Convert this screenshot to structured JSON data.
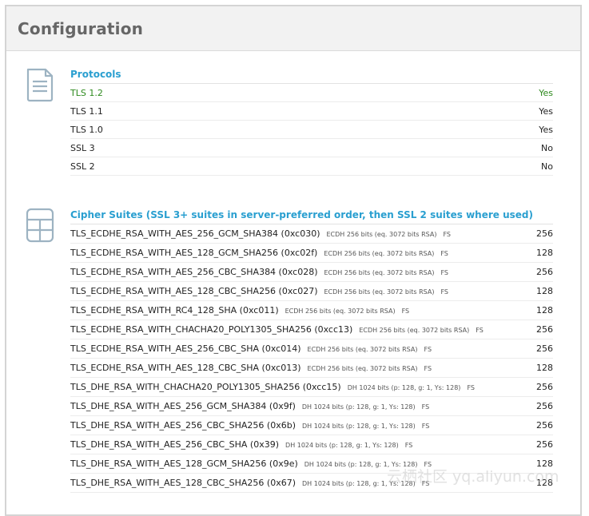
{
  "header": {
    "title": "Configuration"
  },
  "protocols": {
    "title": "Protocols",
    "icon": "document-icon",
    "rows": [
      {
        "label": "TLS 1.2",
        "value": "Yes"
      },
      {
        "label": "TLS 1.1",
        "value": "Yes"
      },
      {
        "label": "TLS 1.0",
        "value": "Yes"
      },
      {
        "label": "SSL 3",
        "value": "No"
      },
      {
        "label": "SSL 2",
        "value": "No"
      }
    ]
  },
  "cipher_suites": {
    "title": "Cipher Suites (SSL 3+ suites in server-preferred order, then SSL 2 suites where used)",
    "icon": "list-icon",
    "rows": [
      {
        "name": "TLS_ECDHE_RSA_WITH_AES_256_GCM_SHA384 (0xc030)",
        "detail": "ECDH 256 bits (eq. 3072 bits RSA)",
        "fs": "FS",
        "bits": "256"
      },
      {
        "name": "TLS_ECDHE_RSA_WITH_AES_128_GCM_SHA256 (0xc02f)",
        "detail": "ECDH 256 bits (eq. 3072 bits RSA)",
        "fs": "FS",
        "bits": "128"
      },
      {
        "name": "TLS_ECDHE_RSA_WITH_AES_256_CBC_SHA384 (0xc028)",
        "detail": "ECDH 256 bits (eq. 3072 bits RSA)",
        "fs": "FS",
        "bits": "256"
      },
      {
        "name": "TLS_ECDHE_RSA_WITH_AES_128_CBC_SHA256 (0xc027)",
        "detail": "ECDH 256 bits (eq. 3072 bits RSA)",
        "fs": "FS",
        "bits": "128"
      },
      {
        "name": "TLS_ECDHE_RSA_WITH_RC4_128_SHA (0xc011)",
        "detail": "ECDH 256 bits (eq. 3072 bits RSA)",
        "fs": "FS",
        "bits": "128"
      },
      {
        "name": "TLS_ECDHE_RSA_WITH_CHACHA20_POLY1305_SHA256 (0xcc13)",
        "detail": "ECDH 256 bits (eq. 3072 bits RSA)",
        "fs": "FS",
        "bits": "256"
      },
      {
        "name": "TLS_ECDHE_RSA_WITH_AES_256_CBC_SHA (0xc014)",
        "detail": "ECDH 256 bits (eq. 3072 bits RSA)",
        "fs": "FS",
        "bits": "256"
      },
      {
        "name": "TLS_ECDHE_RSA_WITH_AES_128_CBC_SHA (0xc013)",
        "detail": "ECDH 256 bits (eq. 3072 bits RSA)",
        "fs": "FS",
        "bits": "128"
      },
      {
        "name": "TLS_DHE_RSA_WITH_CHACHA20_POLY1305_SHA256 (0xcc15)",
        "detail": "DH 1024 bits (p: 128, g: 1, Ys: 128)",
        "fs": "FS",
        "bits": "256"
      },
      {
        "name": "TLS_DHE_RSA_WITH_AES_256_GCM_SHA384 (0x9f)",
        "detail": "DH 1024 bits (p: 128, g: 1, Ys: 128)",
        "fs": "FS",
        "bits": "256"
      },
      {
        "name": "TLS_DHE_RSA_WITH_AES_256_CBC_SHA256 (0x6b)",
        "detail": "DH 1024 bits (p: 128, g: 1, Ys: 128)",
        "fs": "FS",
        "bits": "256"
      },
      {
        "name": "TLS_DHE_RSA_WITH_AES_256_CBC_SHA (0x39)",
        "detail": "DH 1024 bits (p: 128, g: 1, Ys: 128)",
        "fs": "FS",
        "bits": "256"
      },
      {
        "name": "TLS_DHE_RSA_WITH_AES_128_GCM_SHA256 (0x9e)",
        "detail": "DH 1024 bits (p: 128, g: 1, Ys: 128)",
        "fs": "FS",
        "bits": "128"
      },
      {
        "name": "TLS_DHE_RSA_WITH_AES_128_CBC_SHA256 (0x67)",
        "detail": "DH 1024 bits (p: 128, g: 1, Ys: 128)",
        "fs": "FS",
        "bits": "128"
      }
    ]
  },
  "watermark": {
    "text": "云栖社区 yq.aliyun.com"
  },
  "colors": {
    "accent": "#2a9fd0",
    "ok": "#2e8a1e",
    "header_bg": "#f2f2f2",
    "icon": "#9db3c2"
  }
}
